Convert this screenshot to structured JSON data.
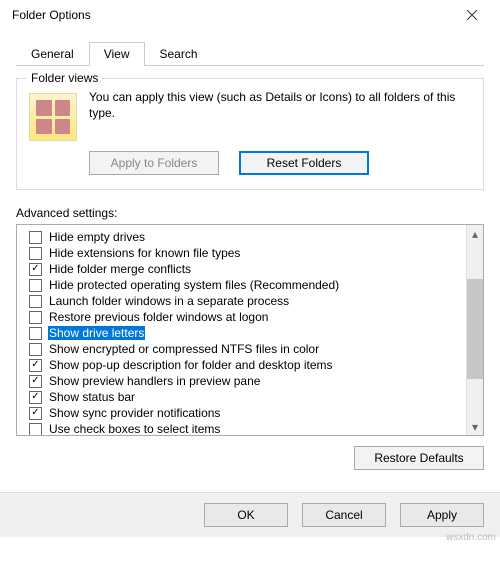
{
  "window": {
    "title": "Folder Options"
  },
  "tabs": {
    "general": "General",
    "view": "View",
    "search": "Search",
    "active": "view"
  },
  "folder_views": {
    "group_title": "Folder views",
    "description": "You can apply this view (such as Details or Icons) to all folders of this type.",
    "apply_button": "Apply to Folders",
    "reset_button": "Reset Folders"
  },
  "advanced_label": "Advanced settings:",
  "settings": [
    {
      "label": "Hide empty drives",
      "checked": false
    },
    {
      "label": "Hide extensions for known file types",
      "checked": false
    },
    {
      "label": "Hide folder merge conflicts",
      "checked": true
    },
    {
      "label": "Hide protected operating system files (Recommended)",
      "checked": false
    },
    {
      "label": "Launch folder windows in a separate process",
      "checked": false
    },
    {
      "label": "Restore previous folder windows at logon",
      "checked": false
    },
    {
      "label": "Show drive letters",
      "checked": false,
      "selected": true
    },
    {
      "label": "Show encrypted or compressed NTFS files in color",
      "checked": false
    },
    {
      "label": "Show pop-up description for folder and desktop items",
      "checked": true
    },
    {
      "label": "Show preview handlers in preview pane",
      "checked": true
    },
    {
      "label": "Show status bar",
      "checked": true
    },
    {
      "label": "Show sync provider notifications",
      "checked": true
    },
    {
      "label": "Use check boxes to select items",
      "checked": false
    }
  ],
  "restore_defaults": "Restore Defaults",
  "footer": {
    "ok": "OK",
    "cancel": "Cancel",
    "apply": "Apply"
  },
  "watermark": "wsxdn.com"
}
